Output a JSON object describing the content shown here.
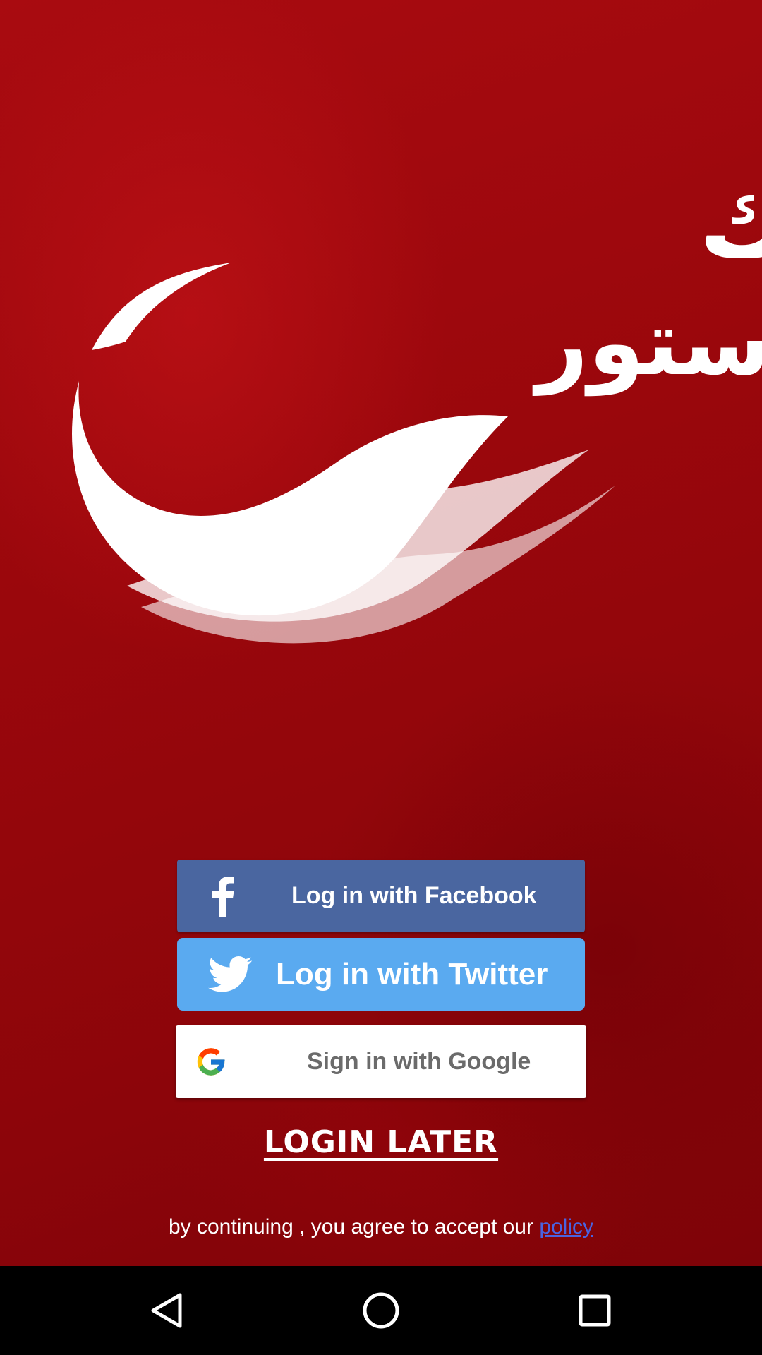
{
  "brand": {
    "logo_text_line1": "شارك",
    "logo_text_line2": "دستور",
    "background_color": "#9a070c",
    "accent_white": "#ffffff"
  },
  "buttons": {
    "facebook": {
      "label": "Log in with Facebook",
      "icon": "facebook-f-icon",
      "color": "#4a66a0"
    },
    "twitter": {
      "label": "Log in with Twitter",
      "icon": "twitter-bird-icon",
      "color": "#5aaaf0"
    },
    "google": {
      "label": "Sign in with Google",
      "icon": "google-g-icon",
      "color": "#ffffff"
    },
    "login_later": "LOGIN LATER"
  },
  "footer": {
    "agree_text": "by continuing , you agree to accept our ",
    "policy_link": "policy",
    "policy_color": "#4a63e0"
  },
  "nav": {
    "back_icon": "back-triangle-icon",
    "home_icon": "home-circle-icon",
    "recents_icon": "recents-square-icon"
  }
}
